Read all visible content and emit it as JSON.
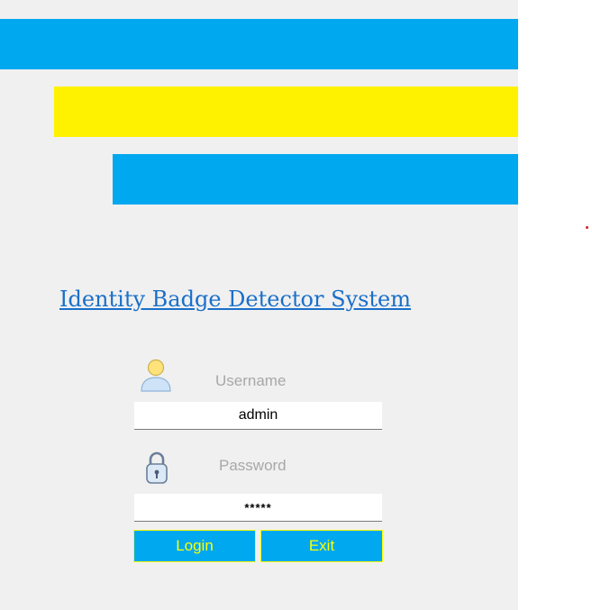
{
  "header": {
    "title": "Identity Badge Detector System"
  },
  "login_form": {
    "username_label": "Username",
    "username_value": "admin",
    "password_label": "Password",
    "password_value": "*****",
    "login_label": "Login",
    "exit_label": "Exit"
  },
  "icons": {
    "user": "user-icon",
    "lock": "lock-icon"
  },
  "colors": {
    "accent_blue": "#00a8f0",
    "accent_yellow": "#fff200",
    "title_link": "#1a6fc9",
    "button_text": "#ffff00",
    "panel_bg": "#f0f0f0",
    "dot_red": "#cc2222"
  }
}
